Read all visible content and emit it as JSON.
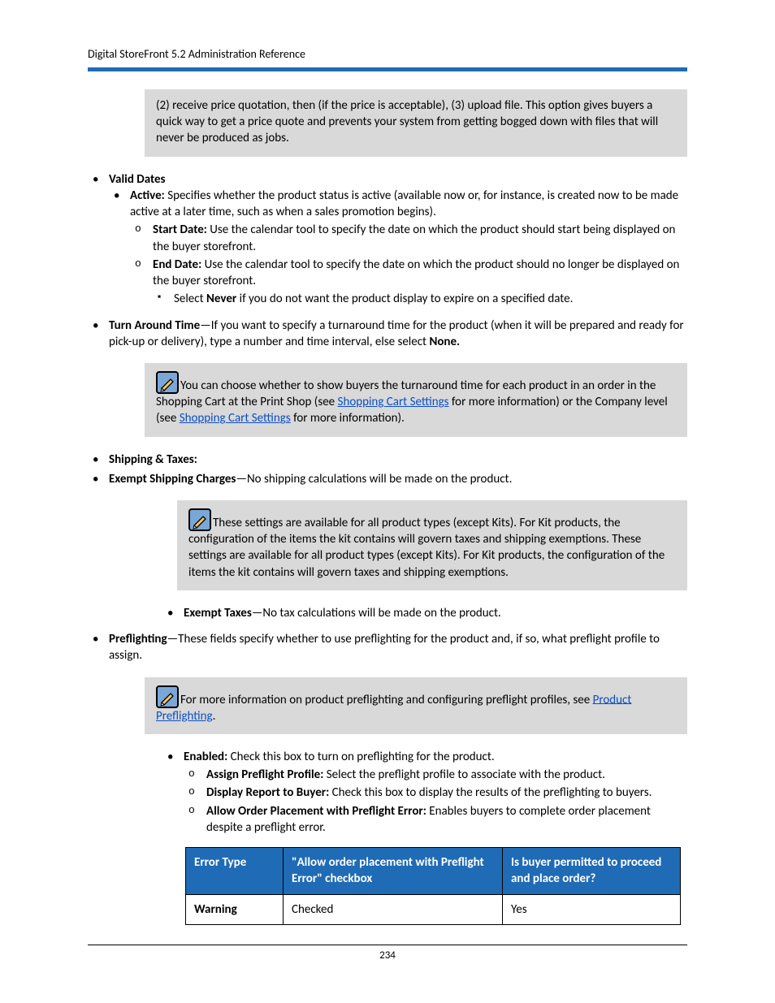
{
  "header": {
    "title": "Digital StoreFront 5.2 Administration Reference"
  },
  "note_intro": {
    "text": "(2) receive price quotation, then (if the price is acceptable), (3) upload file. This option gives buyers a quick way to get a price quote and prevents your system from getting bogged down with files that will never be produced as jobs."
  },
  "valid_dates": {
    "heading": "Valid Dates",
    "active_label": "Active:",
    "active_text": " Specifies whether the product status is active (available now or, for instance, is created now to be made active at a later time, such as when a sales promotion begins).",
    "start_label": "Start Date:",
    "start_text": " Use the calendar tool  to specify the date on which the product should start being displayed on the buyer storefront.",
    "end_label": "End Date:",
    "end_text": " Use the calendar tool to specify the date on which the product should no longer be displayed on the buyer storefront.",
    "never_pre": "Select ",
    "never_bold": "Never",
    "never_post": " if you do not want the product display to expire on a specified date."
  },
  "turnaround": {
    "label": "Turn Around Time",
    "text_pre": "—If you want to specify a turnaround time for the product (when it will be prepared and ready for pick-up or delivery), type a number and time interval, else select ",
    "none_bold": "None.",
    "note_pre": "You can choose whether to show buyers the turnaround time for each product in an order in the Shopping Cart at the Print Shop (see ",
    "link1": "Shopping Cart Settings",
    "note_mid": " for more information) or the Company level (see ",
    "link2": "Shopping Cart Settings",
    "note_post": " for more information)."
  },
  "shipping": {
    "heading": "Shipping & Taxes:",
    "exempt_ship_label": "Exempt Shipping Charges",
    "exempt_ship_text": "—No shipping calculations will be made on the product.",
    "note": "These settings are available for all product types (except Kits). For Kit products, the configuration of the items the kit contains will govern taxes and shipping exemptions. These settings are available for all product types (except Kits). For Kit products, the configuration of the items the kit contains will govern taxes and shipping exemptions.",
    "exempt_tax_label": "Exempt Taxes",
    "exempt_tax_text": "—No tax calculations will be made on the product."
  },
  "preflight": {
    "label": "Preflighting",
    "text": "—These fields specify whether to use preflighting for the product and, if so, what preflight profile to assign.",
    "note_pre": "For more information on product preflighting and configuring preflight profiles, see ",
    "note_link": "Product Preflighting",
    "note_post": ".",
    "enabled_label": "Enabled:",
    "enabled_text": " Check this box to turn on preflighting for the product.",
    "assign_label": "Assign Preflight Profile:",
    "assign_text": " Select the preflight profile to associate with the product.",
    "display_label": "Display Report to Buyer:",
    "display_text": " Check this box to display the results of the preflighting to buyers.",
    "allow_label": "Allow Order Placement with Preflight Error:",
    "allow_text": " Enables buyers to complete order placement despite a preflight error."
  },
  "table": {
    "headers": {
      "col1": "Error Type",
      "col2": "\"Allow order placement with Preflight Error\" checkbox",
      "col3": "Is buyer permitted to proceed and place order?"
    },
    "rows": [
      {
        "c1": "Warning",
        "c2": "Checked",
        "c3": "Yes"
      }
    ]
  },
  "footer": {
    "page_number": "234"
  }
}
